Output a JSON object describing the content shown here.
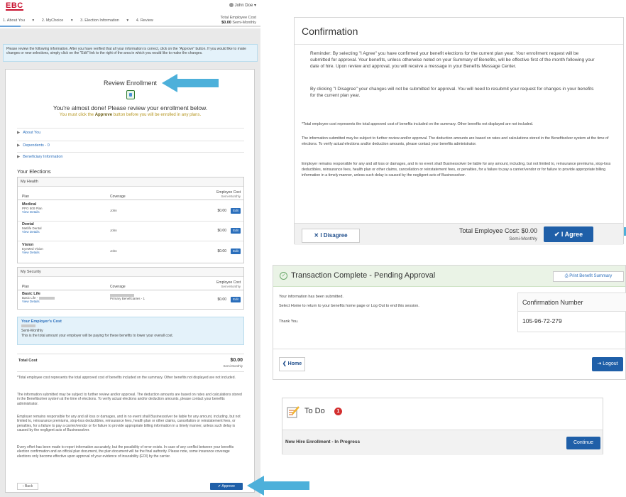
{
  "header": {
    "logo": "EBC",
    "user": "John Doe",
    "steps": [
      "1. About You",
      "2. MyChoice",
      "3. Election Information",
      "4. Review"
    ],
    "total_label": "Total Employee Cost",
    "total_value": "$0.00",
    "total_period": "Semi-Monthly",
    "progress_fraction": 0.08
  },
  "review": {
    "notice": "Please review the following information. After you have verified that all your information is correct, click on the \"Approve\" button. If you would like to make changes or new selections, simply click on the \"Edit\" link to the right of the area in which you would like to make the changes.",
    "title": "Review Enrollment",
    "almost_done": "You're almost done! Please review your enrollment below.",
    "must_pre": "You must click the",
    "must_bold": "Approve",
    "must_post": "button before you will be enrolled in any plans.",
    "accordion": [
      "About You",
      "Dependents - 0",
      "Beneficiary Information"
    ],
    "your_elections": "Your Elections",
    "health": {
      "title": "My Health",
      "col_plan": "Plan",
      "col_coverage": "Coverage",
      "col_cost": "Employee Cost",
      "col_cost_sub": "Semi-Monthly",
      "rows": [
        {
          "name": "Medical",
          "sub": "PPO 500 Plan",
          "link": "View Details",
          "coverage": "John",
          "cost": "$0.00",
          "edit": "Edit"
        },
        {
          "name": "Dental",
          "sub": "Metlife Dental",
          "link": "View Details",
          "coverage": "John",
          "cost": "$0.00",
          "edit": "Edit"
        },
        {
          "name": "Vision",
          "sub": "EyeMed Vision",
          "link": "View Details",
          "coverage": "John",
          "cost": "$0.00",
          "edit": "Edit"
        }
      ]
    },
    "security": {
      "title": "My Security",
      "col_plan": "Plan",
      "col_coverage": "Coverage",
      "col_cost": "Employee Cost",
      "col_cost_sub": "Semi-Monthly",
      "row": {
        "name": "Basic Life",
        "sub": "Basic Life -",
        "link": "View Details",
        "coverage": "Primary Beneficiaries - 1",
        "cost": "$0.00",
        "edit": "Edit"
      }
    },
    "employer": {
      "title": "Your Employer's Cost",
      "period": "Semi-Monthly",
      "desc": "This is the total amount your employer will be paying for these benefits to lower your overall cost."
    },
    "total": {
      "label": "Total Cost",
      "value": "$0.00",
      "period": "Semi-Monthly"
    },
    "footnotes": [
      "*Total employee cost represents the total approved cost of benefits included on the summary. Other benefits not displayed are not included.",
      "The information submitted may be subject to further review and/or approval. The deduction amounts are based on rates and calculations stored in the Benefitsolver system at the time of elections. To verify actual elections and/or deduction amounts, please contact your benefits administrator.",
      "Employer remains responsible for any and all loss or damages, and in no event shall Businessolver be liable for any amount, including, but not limited to, reinsurance premiums, stop-loss deductibles, reinsurance fees, health plan or other claims, cancellation or reinstatement fees, or penalties, for a failure to pay a carrier/vendor or for failure to provide appropriate billing information in a timely manner, unless such delay is caused by the negligent acts of Businessolver.",
      "Every effort has been made to report information accurately, but the possibility of error exists. In case of any conflict between your benefits election confirmation and an official plan document, the plan document will be the final authority. Please note, some insurance coverage elections only become effective upon approval of your evidence of insurability (EOI) by the carrier."
    ],
    "back": "Back",
    "approve": "Approve"
  },
  "confirmation": {
    "title": "Confirmation",
    "p1": "Reminder: By selecting \"I Agree\" you have confirmed your benefit elections for the current plan year. Your enrollment request will be submitted for approval. Your benefits, unless otherwise noted on your Summary of Benefits, will be effective first of the month following your  date of hire. Upon review and approval, you will receive a message in your Benefits Message Center.",
    "p2": "By clicking \"I Disagree\" your changes will not be submitted for approval. You will need to resubmit your request for changes in your benefits for the current plan year.",
    "p3": "*Total employee cost represents the total approved cost of benefits included on the summary. Other benefits not displayed are not included.",
    "p4": "The information submitted may be subject to further review and/or approval. The deduction amounts are based on rates and calculations stored in the Benefitsolver system at the time of elections. To verify actual elections and/or deduction amounts, please contact your benefits administrator.",
    "p5": "Employer remains responsible for any and all loss or damages, and in no event shall Businessolver be liable for any amount, including, but not limited to, reinsurance premiums, stop-loss deductibles, reinsurance fees, health plan or other claims, cancellation or reinstatement fees, or penalties, for a failure to pay a carrier/vendor or for failure to provide appropriate billing information in a timely manner, unless such delay is caused by the negligent acts of Businessolver.",
    "disagree": "I Disagree",
    "total_label": "Total Employee Cost: $0.00",
    "total_period": "Semi-Monthly",
    "agree": "I Agree"
  },
  "transaction": {
    "title": "Transaction Complete - Pending Approval",
    "print": "Print Benefit Summary",
    "line1": "Your information has been submitted.",
    "line2": "Select Home to return to your benefits home page or Log Out to end this session.",
    "line3": "Thank You.",
    "conf_label": "Confirmation Number",
    "conf_number": "105-96-72-279",
    "home": "Home",
    "logout": "Logout"
  },
  "todo": {
    "title": "To Do",
    "badge": "1",
    "item": "New Hire Enrollment - In Progress",
    "continue": "Continue"
  },
  "colors": {
    "primary_button": "#1f5fa8",
    "arrow": "#4db0da",
    "link": "#2a6ebb",
    "success_header": "#eaf3e6",
    "badge": "#d32f2f"
  }
}
